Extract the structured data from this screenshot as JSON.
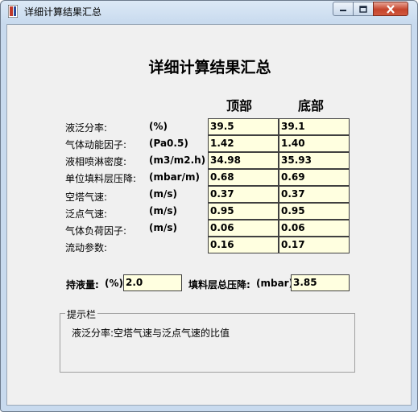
{
  "window": {
    "title": "详细计算结果汇总"
  },
  "heading": "详细计算结果汇总",
  "columns": {
    "top": "顶部",
    "bottom": "底部"
  },
  "rows": [
    {
      "label": "液泛分率:",
      "unit": "(%)",
      "top": "39.5",
      "bottom": "39.1"
    },
    {
      "label": "气体动能因子:",
      "unit": "(Pa0.5)",
      "top": "1.42",
      "bottom": "1.40"
    },
    {
      "label": "液相喷淋密度:",
      "unit": "(m3/m2.h)",
      "top": "34.98",
      "bottom": "35.93"
    },
    {
      "label": "单位填料层压降:",
      "unit": "(mbar/m)",
      "top": "0.68",
      "bottom": "0.69"
    },
    {
      "label": "空塔气速:",
      "unit": "(m/s)",
      "top": "0.37",
      "bottom": "0.37"
    },
    {
      "label": "泛点气速:",
      "unit": "(m/s)",
      "top": "0.95",
      "bottom": "0.95"
    },
    {
      "label": "气体负荷因子:",
      "unit": "(m/s)",
      "top": "0.06",
      "bottom": "0.06"
    },
    {
      "label": "流动参数:",
      "unit": "",
      "top": "0.16",
      "bottom": "0.17"
    }
  ],
  "holdup": {
    "label": "持液量:",
    "unit": "(%)",
    "value": "2.0"
  },
  "pressure_drop": {
    "label": "填料层总压降:",
    "unit": "(mbar)",
    "value": "3.85"
  },
  "hint": {
    "legend": "提示栏",
    "text": "液泛分率:空塔气速与泛点气速的比值"
  },
  "icons": {
    "app": "app-icon",
    "minimize": "minimize-icon",
    "maximize": "maximize-icon",
    "close": "close-icon"
  }
}
